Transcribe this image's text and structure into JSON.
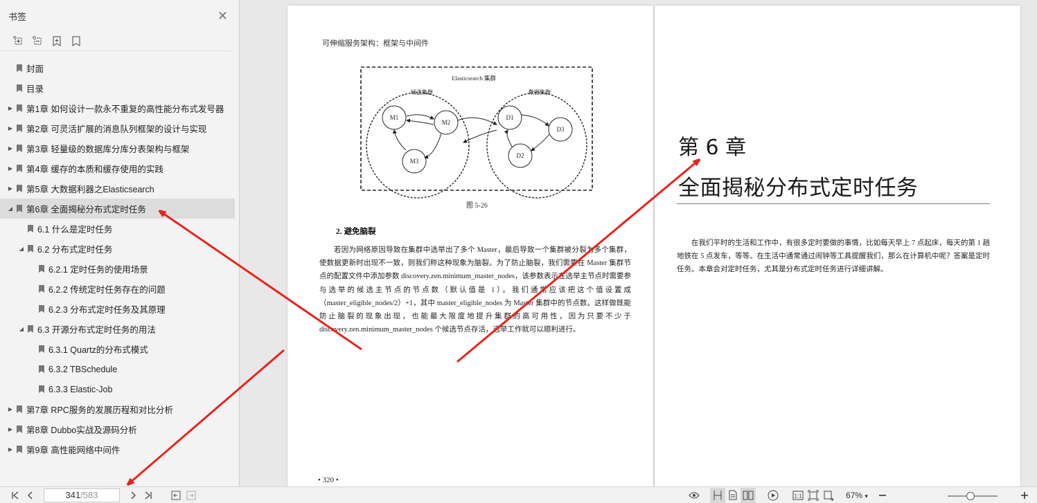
{
  "sidebar": {
    "title": "书签",
    "close_icon": "close-icon",
    "tools": [
      "expand-all-icon",
      "collapse-all-icon",
      "add-bookmark-icon",
      "bookmark-icon"
    ],
    "items": [
      {
        "label": "封面",
        "level": 0,
        "expand": "none"
      },
      {
        "label": "目录",
        "level": 0,
        "expand": "none"
      },
      {
        "label": "第1章 如何设计一款永不重复的高性能分布式发号器",
        "level": 0,
        "expand": "collapsed"
      },
      {
        "label": "第2章 可灵活扩展的消息队列框架的设计与实现",
        "level": 0,
        "expand": "collapsed"
      },
      {
        "label": "第3章 轻量级的数据库分库分表架构与框架",
        "level": 0,
        "expand": "collapsed"
      },
      {
        "label": "第4章 缓存的本质和缓存使用的实践",
        "level": 0,
        "expand": "collapsed"
      },
      {
        "label": "第5章 大数据利器之Elasticsearch",
        "level": 0,
        "expand": "collapsed"
      },
      {
        "label": "第6章 全面揭秘分布式定时任务",
        "level": 0,
        "expand": "expanded",
        "selected": true
      },
      {
        "label": "6.1 什么是定时任务",
        "level": 1,
        "expand": "none"
      },
      {
        "label": "6.2 分布式定时任务",
        "level": 1,
        "expand": "expanded"
      },
      {
        "label": "6.2.1 定时任务的使用场景",
        "level": 2,
        "expand": "none"
      },
      {
        "label": "6.2.2 传统定时任务存在的问题",
        "level": 2,
        "expand": "none"
      },
      {
        "label": "6.2.3 分布式定时任务及其原理",
        "level": 2,
        "expand": "none"
      },
      {
        "label": "6.3 开源分布式定时任务的用法",
        "level": 1,
        "expand": "expanded"
      },
      {
        "label": "6.3.1 Quartz的分布式模式",
        "level": 2,
        "expand": "none"
      },
      {
        "label": "6.3.2 TBSchedule",
        "level": 2,
        "expand": "none"
      },
      {
        "label": "6.3.3 Elastic-Job",
        "level": 2,
        "expand": "none"
      },
      {
        "label": "第7章 RPC服务的发展历程和对比分析",
        "level": 0,
        "expand": "collapsed"
      },
      {
        "label": "第8章 Dubbo实战及源码分析",
        "level": 0,
        "expand": "collapsed"
      },
      {
        "label": "第9章 高性能网络中间件",
        "level": 0,
        "expand": "collapsed"
      }
    ]
  },
  "left_page": {
    "running_head": "可伸缩服务架构：框架与中间件",
    "diagram": {
      "outer_label": "Elasticsearch 集群",
      "left_group": "候选集群",
      "right_group": "数据集群",
      "nodes": [
        "M1",
        "M2",
        "M3",
        "D1",
        "D3",
        "D2"
      ]
    },
    "figure_caption": "图 5-26",
    "section_heading": "2.  避免脑裂",
    "body": "若因为网络原因导致在集群中选举出了多个 Master，最后导致一个集群被分裂为多个集群，使数据更新时出现不一致，则我们称这种现象为脑裂。为了防止脑裂，我们需要在 Master 集群节点的配置文件中添加参数 discovery.zen.minimum_master_nodes，该参数表示在选举主节点时需要参与选举的候选主节点的节点数（默认值是 1）。我们通常应该把这个值设置成（master_eligible_nodes/2）+1，其中 master_eligible_nodes 为 Master 集群中的节点数。这样做既能防止脑裂的现象出现，也能最大限度地提升集群的高可用性，因为只要不少于 discovery.zen.minimum_master_nodes 个候选节点存活，选举工作就可以顺利进行。",
    "page_number": "• 320 •"
  },
  "right_page": {
    "chapter_number": "第 6 章",
    "chapter_title": "全面揭秘分布式定时任务",
    "intro": "在我们平时的生活和工作中，有很多定时要做的事情，比如每天早上 7 点起床，每天的第 1 趟地铁在 5 点发车，等等。在生活中通常通过闹钟等工具提醒我们，那么在计算机中呢？答案是定时任务。本章会对定时任务，尤其是分布式定时任务进行详细讲解。"
  },
  "toolbar": {
    "current_page": "341",
    "total_pages": "/583",
    "zoom": "67%",
    "zoom_level": 0.45,
    "zoom_arrow": "▾"
  },
  "colors": {
    "annotation": "#e8231b",
    "selected_bg": "#dcdcdc"
  }
}
